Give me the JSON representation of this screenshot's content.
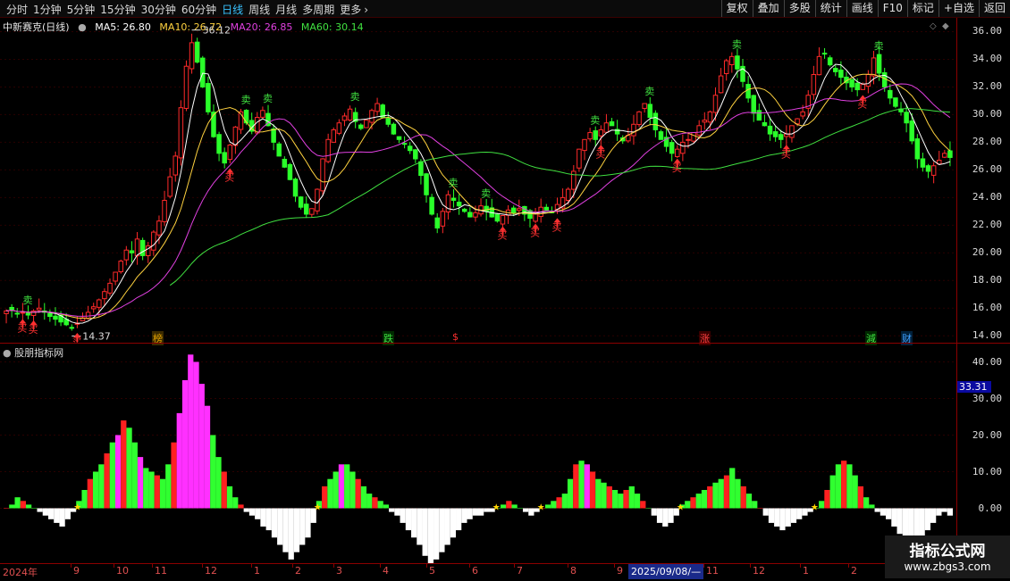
{
  "toolbar": {
    "periods": [
      "分时",
      "1分钟",
      "5分钟",
      "15分钟",
      "30分钟",
      "60分钟",
      "日线",
      "周线",
      "月线",
      "多周期",
      "更多"
    ],
    "active_period": "日线",
    "more_chevron": "›",
    "right_buttons": [
      "复权",
      "叠加",
      "多股",
      "统计",
      "画线",
      "F10",
      "标记",
      "+自选",
      "返回"
    ]
  },
  "stock": {
    "name": "中新赛克(日线)",
    "ma": [
      {
        "label": "MA5: 26.80",
        "color": "#ffffff"
      },
      {
        "label": "MA10: 26.72",
        "color": "#ffd23f"
      },
      {
        "label": "MA20: 26.85",
        "color": "#e040e0"
      },
      {
        "label": "MA60: 30.14",
        "color": "#40e040"
      }
    ]
  },
  "price_axis": {
    "ticks": [
      "36.00",
      "34.00",
      "32.00",
      "30.00",
      "28.00",
      "26.00",
      "24.00",
      "22.00",
      "20.00",
      "18.00",
      "16.00",
      "14.00"
    ]
  },
  "price_labels": {
    "high": "36.12",
    "low": "14.37"
  },
  "signals": {
    "buy": "买",
    "sell": "卖"
  },
  "events": [
    {
      "text": "榜",
      "color": "#e0a000",
      "bg": "#3a2a00"
    },
    {
      "text": "跌",
      "color": "#40e040",
      "bg": "#002a00"
    },
    {
      "text": "$",
      "color": "#ff3030",
      "bg": "#000"
    },
    {
      "text": "涨",
      "color": "#ff4040",
      "bg": "#3a0000"
    },
    {
      "text": "減",
      "color": "#40e040",
      "bg": "#002a00"
    },
    {
      "text": "财",
      "color": "#40a0ff",
      "bg": "#00203a"
    }
  ],
  "indicator": {
    "title": "股朋指标网",
    "current_value": "33.31",
    "axis_ticks": [
      "40.00",
      "30.00",
      "20.00",
      "10.00",
      "0.00"
    ]
  },
  "date_axis": {
    "year_label": "2024年",
    "months": [
      "9",
      "10",
      "11",
      "12",
      "1",
      "2",
      "3",
      "4",
      "5",
      "6",
      "7",
      "8",
      "9",
      "11",
      "12",
      "1",
      "2"
    ],
    "cursor_date": "2025/09/08/—"
  },
  "watermark": {
    "title": "指标公式网",
    "url": "www.zbgs3.com"
  },
  "chart_data": {
    "type": "candlestick",
    "y_range": [
      13.5,
      37.0
    ],
    "high_marker": 36.12,
    "low_marker": 14.37,
    "closes": [
      15.8,
      15.9,
      15.6,
      15.7,
      15.5,
      15.8,
      16.0,
      15.7,
      15.4,
      15.2,
      15.0,
      14.8,
      14.6,
      14.9,
      15.3,
      15.7,
      16.1,
      16.6,
      17.2,
      17.8,
      18.6,
      19.4,
      20.2,
      20.0,
      21.0,
      19.8,
      20.5,
      21.5,
      22.3,
      23.8,
      25.5,
      27.0,
      30.5,
      33.5,
      35.2,
      33.8,
      32.0,
      30.2,
      28.4,
      27.2,
      26.5,
      27.8,
      29.1,
      30.2,
      29.4,
      28.8,
      29.8,
      30.3,
      29.2,
      28.0,
      27.0,
      26.2,
      25.3,
      24.1,
      23.3,
      22.8,
      23.2,
      24.6,
      26.8,
      28.2,
      28.9,
      29.4,
      29.9,
      30.4,
      29.5,
      29.0,
      29.6,
      30.3,
      30.8,
      29.8,
      29.3,
      28.6,
      28.2,
      27.9,
      27.4,
      26.8,
      25.6,
      24.2,
      22.8,
      21.8,
      23.0,
      24.2,
      23.8,
      23.4,
      23.0,
      22.6,
      22.9,
      23.4,
      23.0,
      22.6,
      22.3,
      22.7,
      23.1,
      22.9,
      23.2,
      22.8,
      22.5,
      22.9,
      23.3,
      23.1,
      22.9,
      23.5,
      24.0,
      24.6,
      25.9,
      27.5,
      28.2,
      28.7,
      28.2,
      28.9,
      29.4,
      29.2,
      28.6,
      28.1,
      28.5,
      29.3,
      30.2,
      30.8,
      29.8,
      28.9,
      28.2,
      27.7,
      27.2,
      27.5,
      28.0,
      28.2,
      28.7,
      29.2,
      29.6,
      30.2,
      31.4,
      32.8,
      33.9,
      34.2,
      33.3,
      32.4,
      31.2,
      30.1,
      29.6,
      29.2,
      28.6,
      28.4,
      28.2,
      28.6,
      29.2,
      29.7,
      30.2,
      31.4,
      32.9,
      34.2,
      34.4,
      33.6,
      33.1,
      32.7,
      32.3,
      32.0,
      31.8,
      32.2,
      32.9,
      34.1,
      33.0,
      32.0,
      31.2,
      30.6,
      30.2,
      29.4,
      28.1,
      26.8,
      26.2,
      25.9,
      26.3,
      26.7,
      27.2,
      26.9
    ],
    "indicator_values": [
      0,
      1,
      3,
      2,
      1,
      0,
      -1,
      -2,
      -3,
      -4,
      -5,
      -3,
      -1,
      2,
      5,
      8,
      10,
      12,
      15,
      18,
      20,
      24,
      22,
      18,
      14,
      11,
      10,
      9,
      8,
      12,
      18,
      26,
      35,
      42,
      40,
      34,
      28,
      20,
      14,
      10,
      6,
      3,
      1,
      -1,
      -2,
      -3,
      -5,
      -6,
      -8,
      -10,
      -12,
      -14,
      -12,
      -10,
      -8,
      -4,
      2,
      6,
      8,
      10,
      12,
      12,
      10,
      8,
      6,
      4,
      3,
      2,
      1,
      -1,
      -2,
      -4,
      -6,
      -8,
      -10,
      -13,
      -15,
      -14,
      -12,
      -10,
      -8,
      -6,
      -4,
      -3,
      -2,
      -2,
      -1,
      -1,
      0,
      1,
      2,
      1,
      0,
      -1,
      -2,
      -1,
      0,
      1,
      2,
      3,
      4,
      8,
      12,
      13,
      12,
      10,
      8,
      7,
      6,
      5,
      4,
      5,
      6,
      4,
      2,
      0,
      -2,
      -4,
      -5,
      -4,
      -2,
      1,
      2,
      3,
      4,
      5,
      6,
      7,
      8,
      9,
      11,
      8,
      6,
      4,
      2,
      0,
      -2,
      -4,
      -5,
      -6,
      -5,
      -4,
      -3,
      -2,
      -1,
      0,
      2,
      5,
      9,
      12,
      13,
      12,
      9,
      6,
      3,
      1,
      -1,
      -2,
      -3,
      -5,
      -7,
      -8,
      -9,
      -10,
      -8,
      -6,
      -4,
      -2,
      -1,
      -2
    ]
  }
}
